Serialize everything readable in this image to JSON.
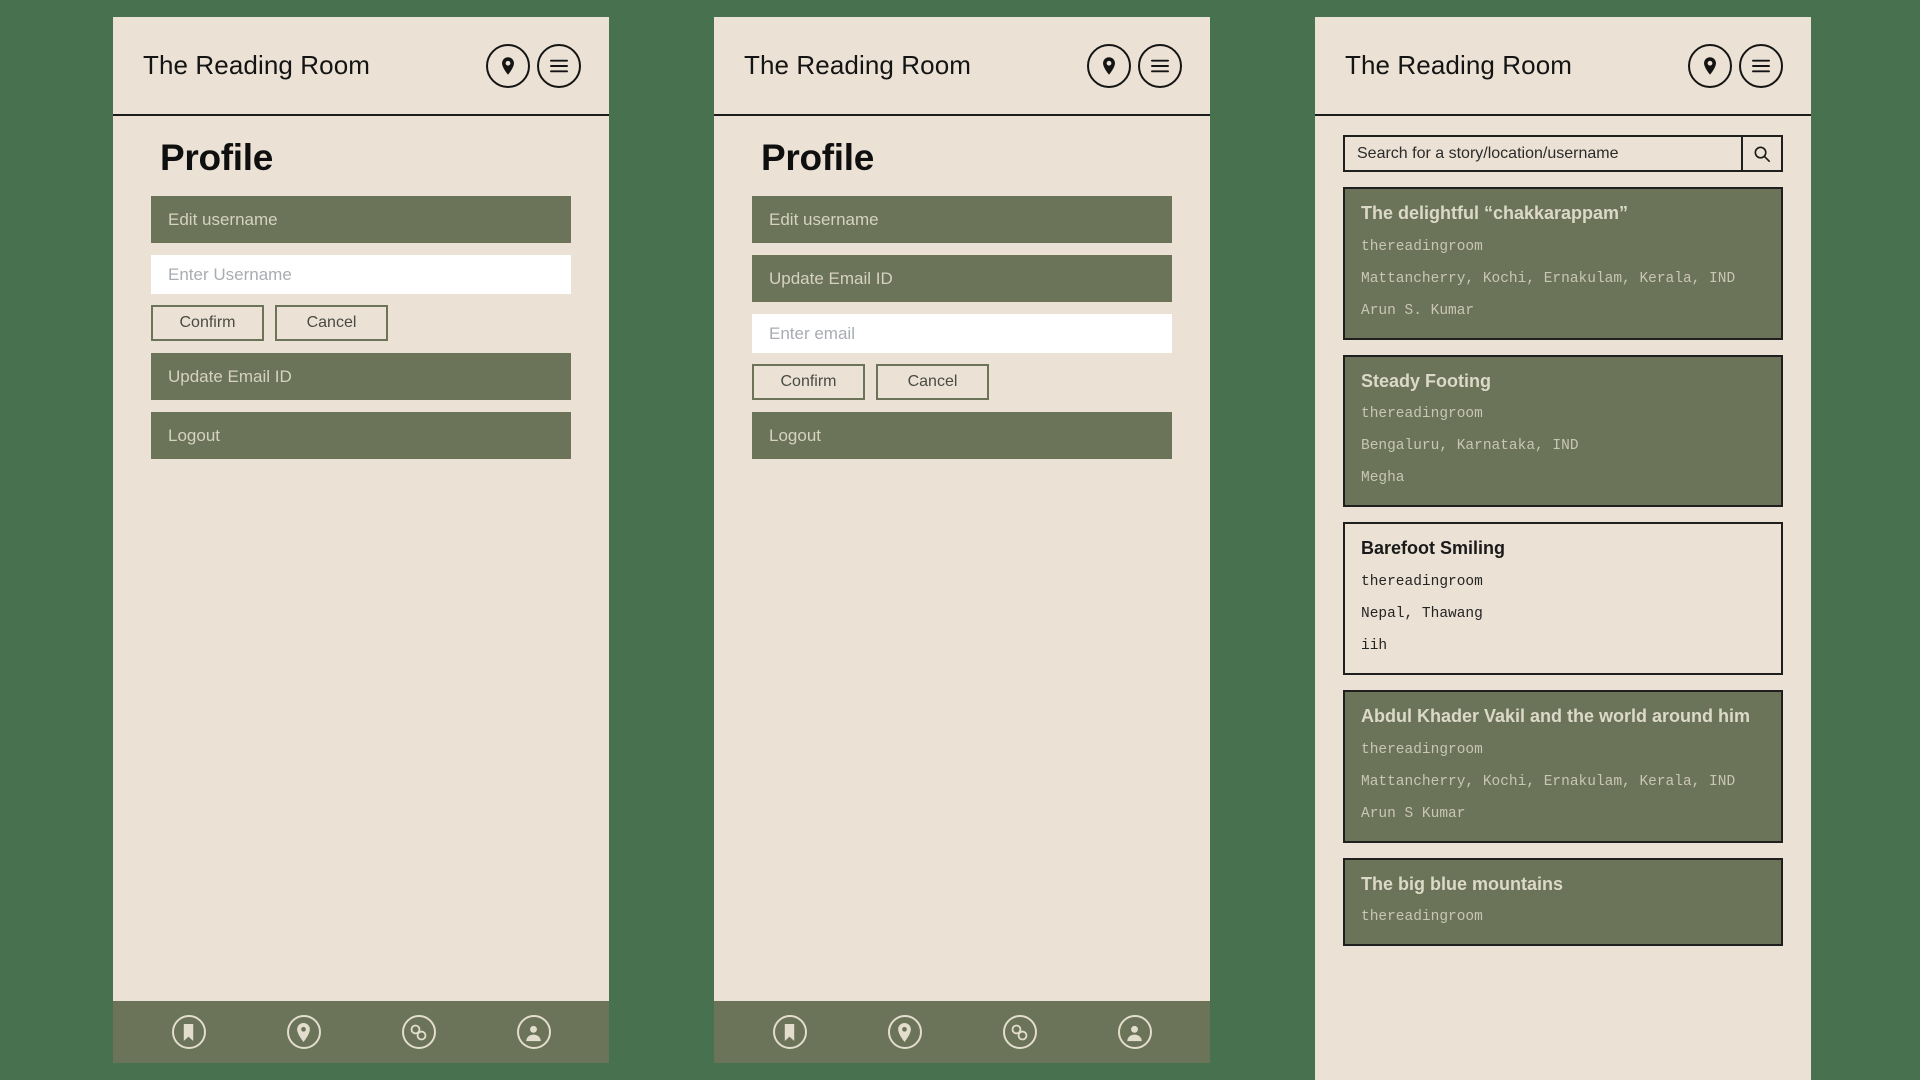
{
  "app": {
    "title": "The Reading Room",
    "header_icons": [
      {
        "name": "location-pin-icon",
        "label": "Location"
      },
      {
        "name": "hamburger-menu-icon",
        "label": "Menu"
      }
    ],
    "bottom_nav": [
      {
        "name": "bookmark-icon",
        "label": "Saved"
      },
      {
        "name": "location-pin-icon",
        "label": "Map"
      },
      {
        "name": "link-icon",
        "label": "Links"
      },
      {
        "name": "profile-avatar-icon",
        "label": "Profile"
      }
    ]
  },
  "colors": {
    "page_background": "#487150",
    "panel_background": "#EBE2D5",
    "accent_green": "#6B7358",
    "text_dark": "#141414",
    "text_on_green": "#D6D2C0",
    "input_white": "#FFFFFF",
    "border_dark": "#1f1f1f"
  },
  "screen1": {
    "page_title": "Profile",
    "edit_username_label": "Edit username",
    "username_placeholder": "Enter Username",
    "username_value": "",
    "confirm_label": "Confirm",
    "cancel_label": "Cancel",
    "update_email_label": "Update Email ID",
    "logout_label": "Logout"
  },
  "screen2": {
    "page_title": "Profile",
    "edit_username_label": "Edit username",
    "update_email_label": "Update Email ID",
    "email_placeholder": "Enter email",
    "email_value": "",
    "confirm_label": "Confirm",
    "cancel_label": "Cancel",
    "logout_label": "Logout"
  },
  "screen3": {
    "search_placeholder": "Search for a story/location/username",
    "search_value": "",
    "search_button_icon": "search-icon",
    "stories": [
      {
        "title": "The delightful “chakkarappam”",
        "username": "thereadingroom",
        "location": "Mattancherry, Kochi, Ernakulam, Kerala, IND",
        "author": "Arun S. Kumar",
        "style": "dark"
      },
      {
        "title": "Steady Footing",
        "username": "thereadingroom",
        "location": "Bengaluru, Karnataka, IND",
        "author": "Megha",
        "style": "dark"
      },
      {
        "title": "Barefoot Smiling",
        "username": "thereadingroom",
        "location": "Nepal, Thawang",
        "author": "iih",
        "style": "light"
      },
      {
        "title": "Abdul Khader Vakil and the world around him",
        "username": "thereadingroom",
        "location": "Mattancherry, Kochi, Ernakulam, Kerala, IND",
        "author": "Arun S Kumar",
        "style": "dark"
      },
      {
        "title": "The big blue mountains",
        "username": "thereadingroom",
        "location": "",
        "author": "",
        "style": "dark"
      }
    ]
  }
}
